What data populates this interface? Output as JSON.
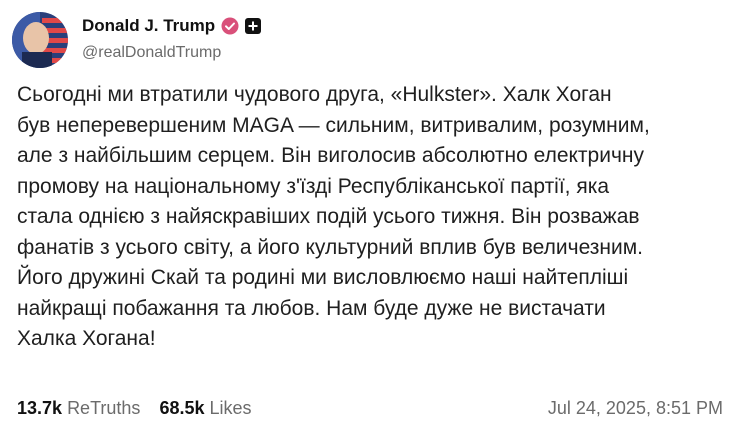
{
  "author": {
    "display_name": "Donald J. Trump",
    "handle": "@realDonaldTrump"
  },
  "post": {
    "text": "Сьогодні ми втратили чудового друга, «Hulkster». Халк Хоган\nбув неперевершеним MAGA — сильним, витривалим, розумним,\nале з найбільшим серцем. Він виголосив абсолютно електричну\nпромову на національному з'їзді Республіканської партії, яка\nстала однією з найяскравіших подій усього тижня. Він розважав\nфанатів з усього світу, а його культурний вплив був величезним.\nЙого дружині Скай та родині ми висловлюємо наші найтепліші\nнайкращі побажання та любов. Нам буде дуже не вистачати\nХалка Хогана!"
  },
  "stats": {
    "retruths_count": "13.7k",
    "retruths_label": "ReTruths",
    "likes_count": "68.5k",
    "likes_label": "Likes",
    "timestamp": "Jul 24, 2025, 8:51 PM"
  },
  "colors": {
    "verified_badge": "#d9507a",
    "secondary_text": "#6b6b6b"
  },
  "icons": [
    "avatar",
    "verified-badge-icon",
    "plus-icon"
  ]
}
